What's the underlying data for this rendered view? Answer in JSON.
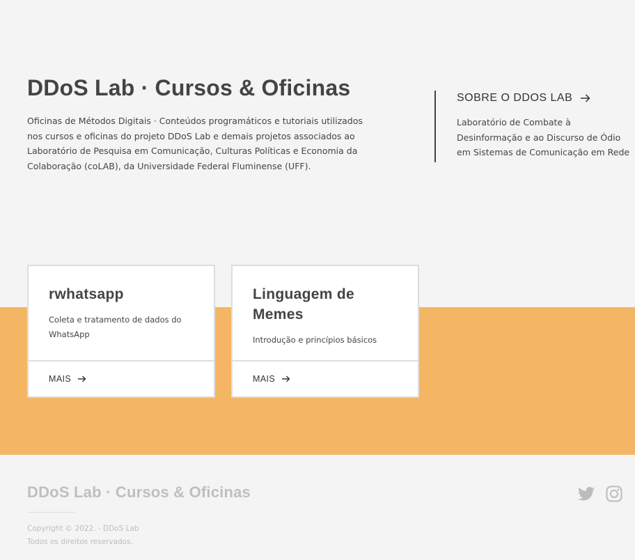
{
  "hero": {
    "title": "DDoS Lab · Cursos & Oficinas",
    "description": "Oficinas de Métodos Digitais · Conteúdos programáticos e tutoriais utilizados nos cursos e oficinas do projeto DDoS Lab e demais projetos associados ao Laboratório de Pesquisa em Comunicação, Culturas Políticas e Economia da Colaboração (coLAB), da Universidade Federal Fluminense (UFF)."
  },
  "about": {
    "link_label": "SOBRE O DDOS LAB",
    "description": "Laboratório de Combate à Desinformação e ao Discurso de Ódio em Sistemas de Comunicação em Rede",
    "arrow_icon": "arrow-right-icon"
  },
  "courses": [
    {
      "title": "rwhatsapp",
      "description": "Coleta e tratamento de dados do WhatsApp",
      "more_label": "MAIS"
    },
    {
      "title": "Linguagem de Memes",
      "description": "Introdução e princípios básicos",
      "more_label": "MAIS"
    }
  ],
  "footer": {
    "title": "DDoS Lab · Cursos & Oficinas",
    "copyright": "Copyright © 2022. - DDoS Lab",
    "rights": "Todos os direitos reservados.",
    "social_icons": [
      "twitter-icon",
      "instagram-icon"
    ]
  },
  "colors": {
    "accent_band": "#f4b664",
    "background": "#f4f4f4",
    "text": "#444444",
    "footer_muted": "#bfbfbf"
  }
}
